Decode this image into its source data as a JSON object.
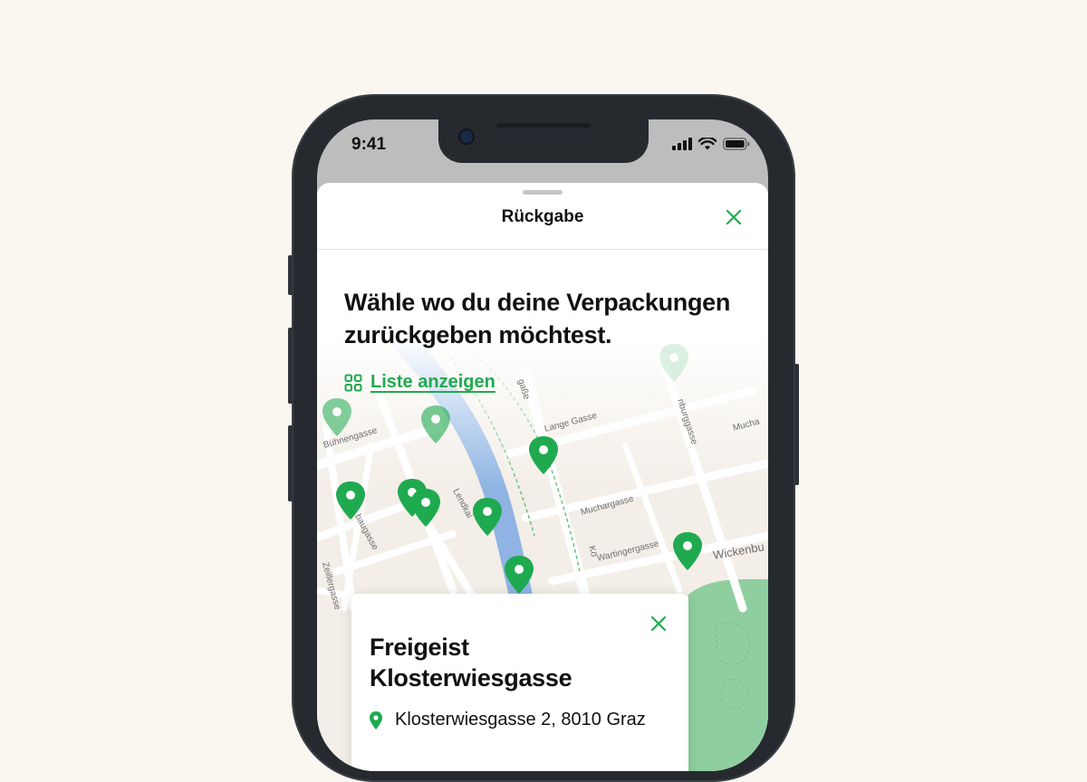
{
  "status_bar": {
    "time": "9:41"
  },
  "sheet": {
    "title": "Rückgabe",
    "close_icon": "close-icon"
  },
  "headline": "Wähle wo du deine Verpackungen zurückgeben möchtest.",
  "list_link": {
    "label": "Liste anzeigen",
    "icon": "grid-icon"
  },
  "map": {
    "streets": [
      "Lendkai",
      "Bühnengasse",
      "Lange Gasse",
      "Muchargasse",
      "Wartingergasse",
      "Zeillergasse",
      "Wickenbu",
      "baugasse",
      "gaße",
      "nburggasse",
      "Mucha",
      "Kö"
    ]
  },
  "location_card": {
    "name": "Freigeist Klosterwiesgasse",
    "address": "Klosterwiesgasse 2, 8010 Graz"
  },
  "colors": {
    "accent": "#1faa50",
    "river": "#8fb4e3",
    "park": "#8fcf9f",
    "background": "#faf7f1"
  }
}
